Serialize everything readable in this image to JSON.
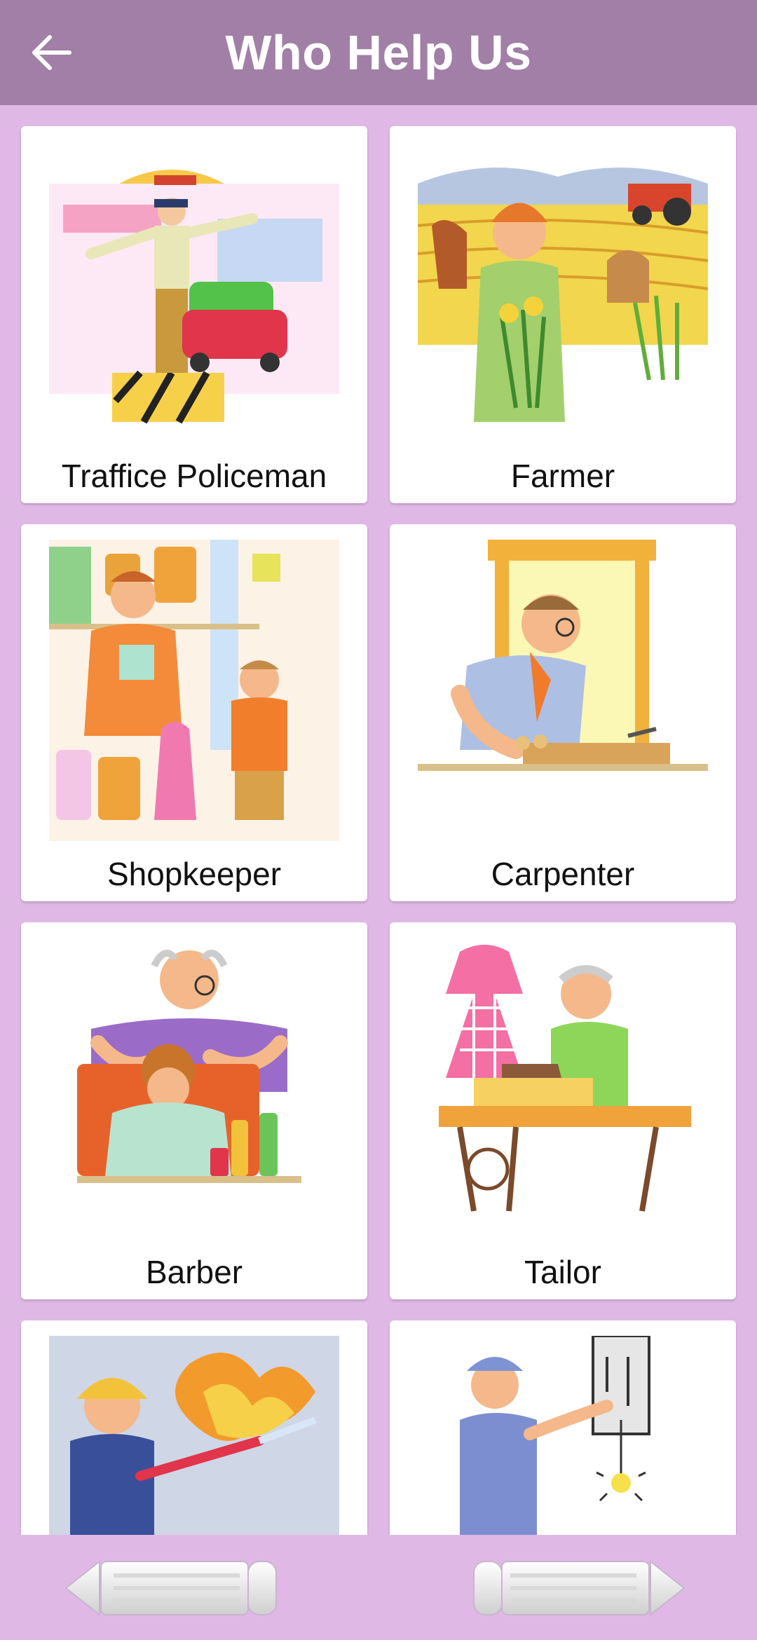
{
  "header": {
    "title": "Who Help Us",
    "back_icon": "arrow-left-icon"
  },
  "cards": [
    {
      "label": "Traffice Policeman",
      "icon": "traffic-policeman-illustration"
    },
    {
      "label": "Farmer",
      "icon": "farmer-illustration"
    },
    {
      "label": "Shopkeeper",
      "icon": "shopkeeper-illustration"
    },
    {
      "label": "Carpenter",
      "icon": "carpenter-illustration"
    },
    {
      "label": "Barber",
      "icon": "barber-illustration"
    },
    {
      "label": "Tailor",
      "icon": "tailor-illustration"
    },
    {
      "label": "",
      "icon": "fireman-illustration"
    },
    {
      "label": "",
      "icon": "electrician-illustration"
    }
  ],
  "navigation": {
    "prev_icon": "pencil-arrow-left-icon",
    "next_icon": "pencil-arrow-right-icon"
  },
  "colors": {
    "appbar": "#a17fa6",
    "background": "#e0b8e6",
    "card": "#ffffff"
  }
}
